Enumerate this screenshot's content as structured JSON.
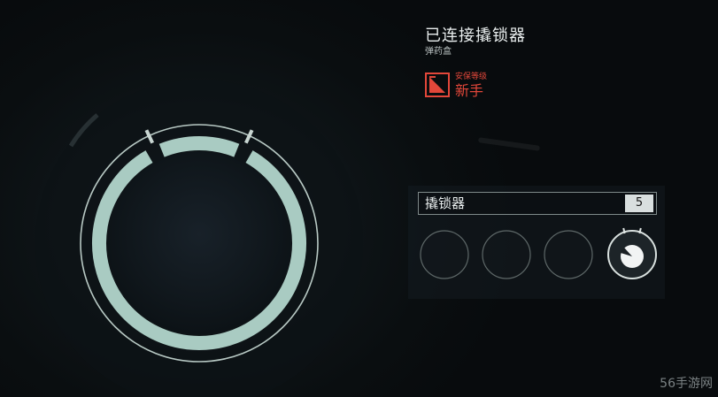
{
  "status": {
    "title": "已连接撬锁器",
    "subtitle": "弹药盒"
  },
  "skill": {
    "label": "安保等级",
    "value": "新手",
    "color": "#e2473a",
    "icon": "lock-level-icon"
  },
  "lockpick": {
    "label": "撬锁器",
    "count": "5",
    "slots": [
      {
        "filled": false
      },
      {
        "filled": false
      },
      {
        "filled": false
      },
      {
        "filled": true
      }
    ]
  },
  "lock": {
    "ring_color": "#a9cbc2",
    "segments": 3,
    "notches": 2
  },
  "watermark": "56手游网"
}
